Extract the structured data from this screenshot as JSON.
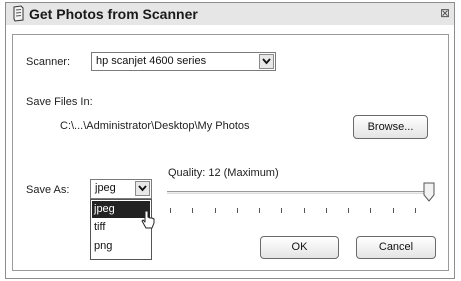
{
  "window": {
    "title": "Get Photos from Scanner",
    "title_icon": "scanner-icon",
    "close_icon": "close-icon",
    "close_glyph": "⊠"
  },
  "scanner": {
    "label": "Scanner:",
    "selected": "hp scanjet 4600 series"
  },
  "save_files": {
    "label": "Save Files In:",
    "path": "C:\\...\\Administrator\\Desktop\\My Photos",
    "browse_label": "Browse..."
  },
  "save_as": {
    "label": "Save As:",
    "selected": "jpeg",
    "options": [
      "jpeg",
      "tiff",
      "png"
    ],
    "highlighted_index": 0
  },
  "quality": {
    "label": "Quality: 12 (Maximum)",
    "value": 12,
    "max": 12
  },
  "buttons": {
    "ok_label": "OK",
    "cancel_label": "Cancel"
  },
  "colors": {
    "highlight": "#222222",
    "titlebar": "#e6e6e6"
  }
}
